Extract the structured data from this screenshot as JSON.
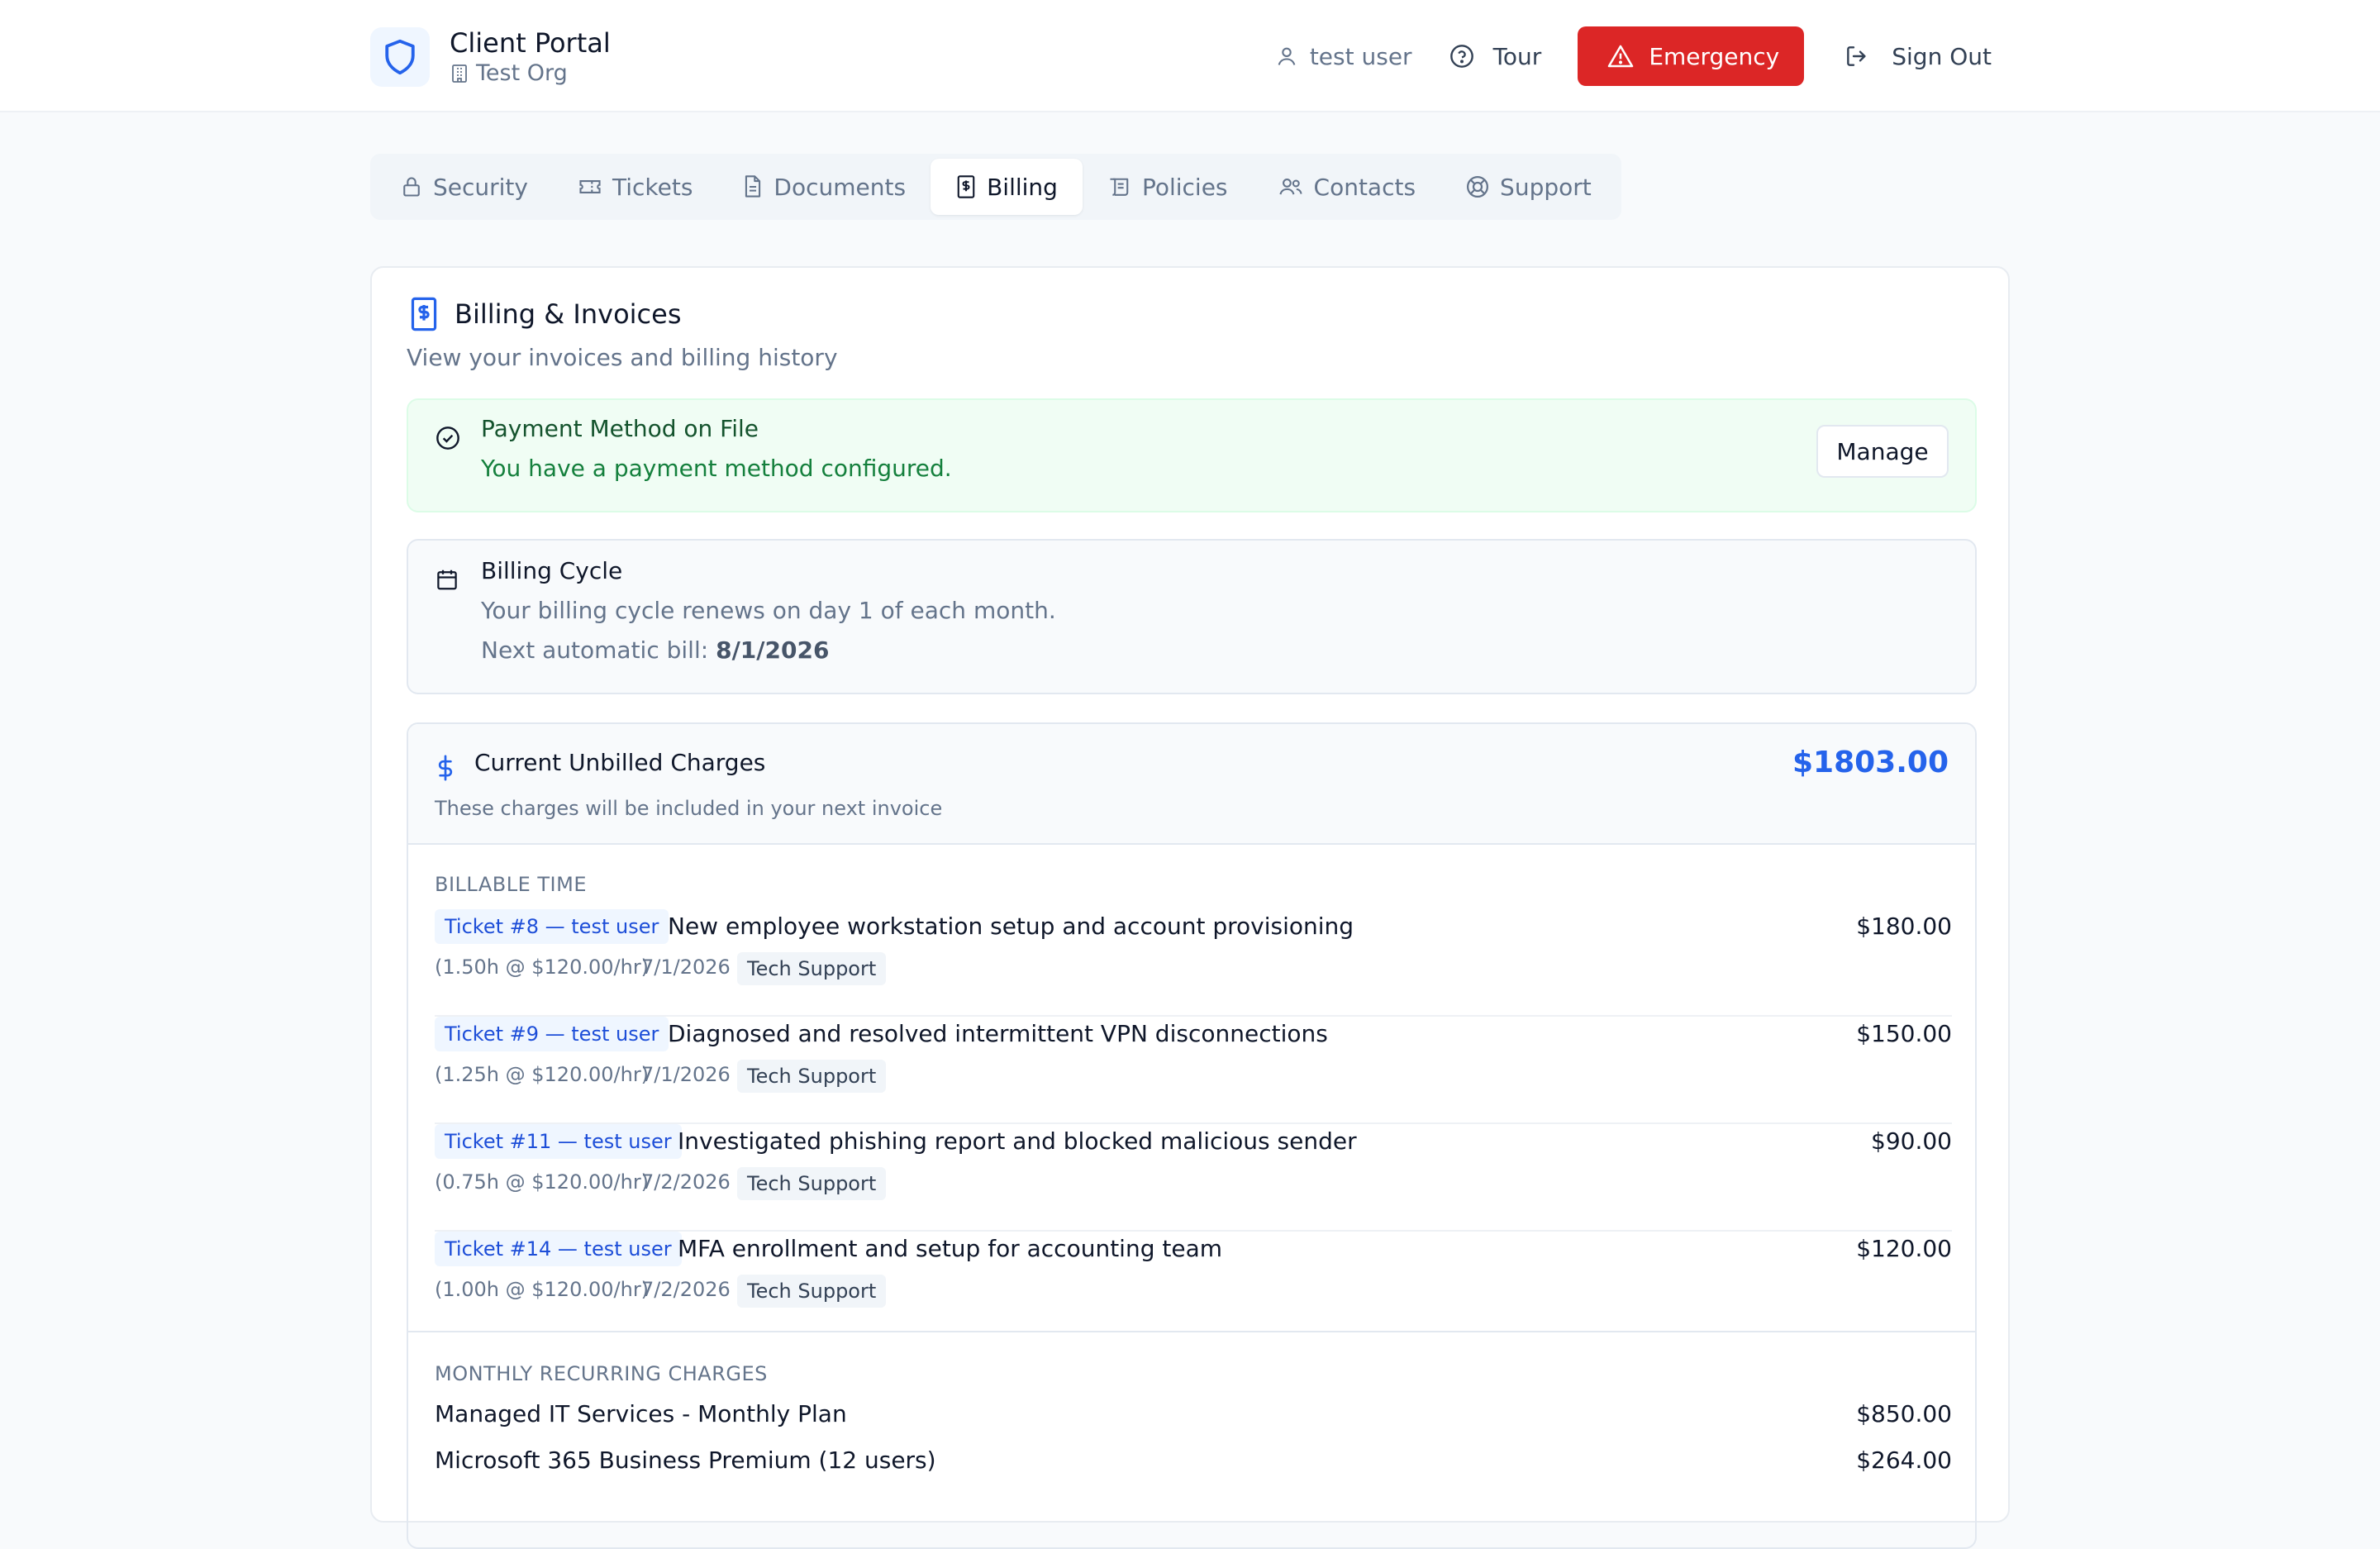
{
  "app": {
    "title": "Client Portal",
    "org": "Test Org"
  },
  "header": {
    "user": "test user",
    "tour": "Tour",
    "emergency": "Emergency",
    "sign_out": "Sign Out"
  },
  "tabs": [
    {
      "label": "Security",
      "icon": "lock-icon"
    },
    {
      "label": "Tickets",
      "icon": "ticket-icon"
    },
    {
      "label": "Documents",
      "icon": "document-icon"
    },
    {
      "label": "Billing",
      "icon": "receipt-icon",
      "active": true
    },
    {
      "label": "Policies",
      "icon": "scroll-icon"
    },
    {
      "label": "Contacts",
      "icon": "users-icon"
    },
    {
      "label": "Support",
      "icon": "lifebuoy-icon"
    }
  ],
  "billing": {
    "title": "Billing & Invoices",
    "subtitle": "View your invoices and billing history",
    "payment": {
      "title": "Payment Method on File",
      "message": "You have a payment method configured.",
      "manage": "Manage"
    },
    "cycle": {
      "title": "Billing Cycle",
      "text": "Your billing cycle renews on day 1 of each month.",
      "next_label": "Next automatic bill:",
      "next_date": "8/1/2026"
    },
    "charges": {
      "title": "Current Unbilled Charges",
      "total": "$1803.00",
      "description": "These charges will be included in your next invoice",
      "billable_label": "BILLABLE TIME",
      "billable": [
        {
          "ticket": "Ticket #8 — test user",
          "desc": "New employee workstation setup and account provisioning",
          "meta": "(1.50h @ $120.00/hr)",
          "date": "7/1/2026",
          "category": "Tech Support",
          "amount": "$180.00"
        },
        {
          "ticket": "Ticket #9 — test user",
          "desc": "Diagnosed and resolved intermittent VPN disconnections",
          "meta": "(1.25h @ $120.00/hr)",
          "date": "7/1/2026",
          "category": "Tech Support",
          "amount": "$150.00"
        },
        {
          "ticket": "Ticket #11 — test user",
          "desc": "Investigated phishing report and blocked malicious sender",
          "meta": "(0.75h @ $120.00/hr)",
          "date": "7/2/2026",
          "category": "Tech Support",
          "amount": "$90.00"
        },
        {
          "ticket": "Ticket #14 — test user",
          "desc": "MFA enrollment and setup for accounting team",
          "meta": "(1.00h @ $120.00/hr)",
          "date": "7/2/2026",
          "category": "Tech Support",
          "amount": "$120.00"
        }
      ],
      "recurring_label": "MONTHLY RECURRING CHARGES",
      "recurring": [
        {
          "name": "Managed IT Services - Monthly Plan",
          "amount": "$850.00"
        },
        {
          "name": "Microsoft 365 Business Premium (12 users)",
          "amount": "$264.00"
        }
      ]
    }
  },
  "colors": {
    "accent": "#2563eb",
    "danger": "#dc2626",
    "success": "#15803d"
  }
}
